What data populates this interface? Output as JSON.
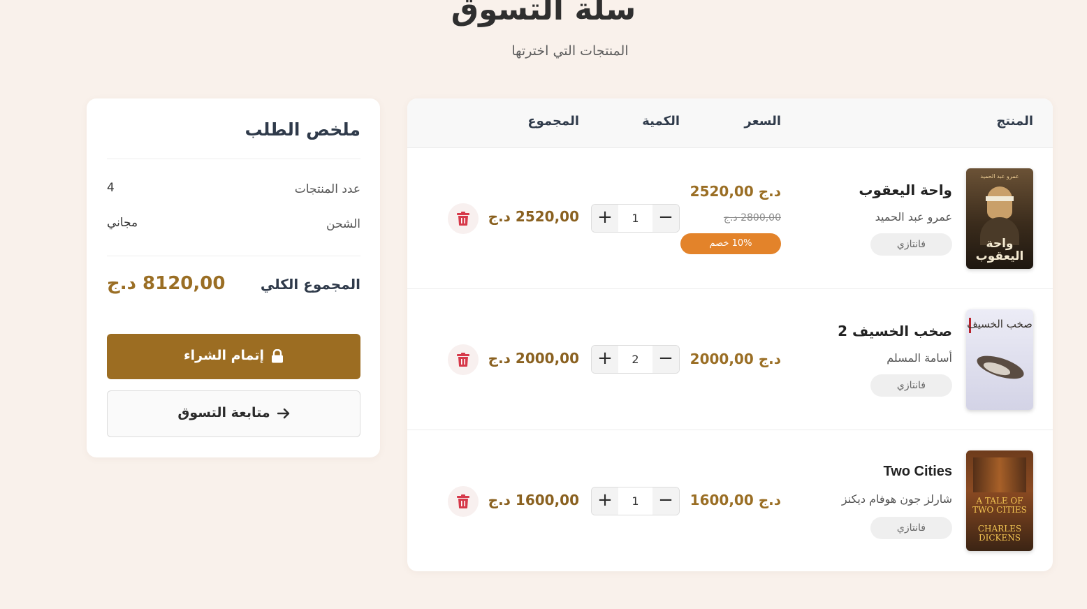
{
  "page": {
    "title": "سلة التسوق",
    "subtitle": "المنتجات التي اخترتها"
  },
  "cart": {
    "headers": {
      "product": "المنتج",
      "price": "السعر",
      "quantity": "الكمية",
      "total": "المجموع"
    },
    "items": [
      {
        "title": "واحة اليعقوب",
        "author": "عمرو عبد الحميد",
        "category": "فانتازي",
        "price": "2520,00 د.ج",
        "old_price": "2800,00 د.ج",
        "discount": "10% خصم",
        "quantity": "1",
        "line_total": "2520,00 د.ج",
        "cover_text": "واحة اليعقوب",
        "cover_author": "عمرو عبد الحميد",
        "cover_colors": [
          "#2a2116",
          "#6b5236",
          "#c9a06a"
        ]
      },
      {
        "title": "صخب الخسيف 2",
        "author": "أسامة المسلم",
        "category": "فانتازي",
        "price": "2000,00 د.ج",
        "quantity": "2",
        "line_total": "2000,00 د.ج",
        "cover_text": "صخب الخسيف",
        "cover_colors": [
          "#e6e6f2",
          "#c9c9dd",
          "#3a3530"
        ]
      },
      {
        "title": "Two Cities",
        "author": "شارلز جون هوفام ديكنز",
        "category": "فانتازي",
        "price": "1600,00 د.ج",
        "quantity": "1",
        "line_total": "1600,00 د.ج",
        "cover_text": "A TALE OF TWO CITIES",
        "cover_author": "CHARLES DICKENS",
        "cover_colors": [
          "#3b2414",
          "#8a4a22",
          "#e0b04a"
        ]
      }
    ]
  },
  "summary": {
    "title": "ملخص الطلب",
    "items_count_label": "عدد المنتجات",
    "items_count": "4",
    "shipping_label": "الشحن",
    "shipping_value": "مجاني",
    "grand_total_label": "المجموع الكلي",
    "grand_total": "8120,00 د.ج",
    "checkout_label": "إتمام الشراء",
    "continue_label": "متابعة التسوق"
  },
  "colors": {
    "background": "#f9f1eb",
    "accent": "#9c6d22",
    "discount": "#e3832a",
    "delete": "#d6394a"
  }
}
